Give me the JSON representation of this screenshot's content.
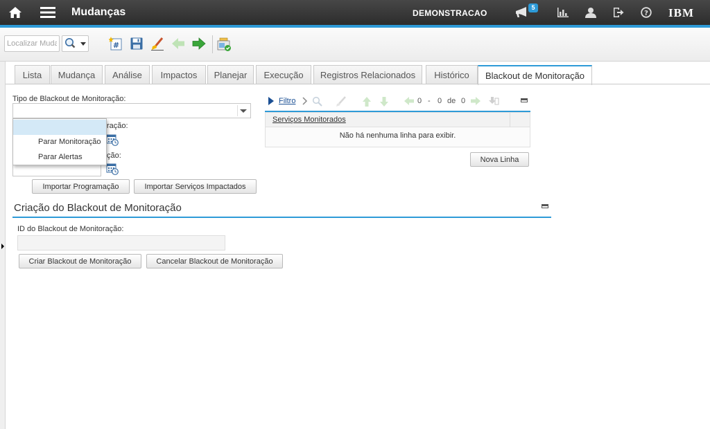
{
  "header": {
    "app_title": "Mudanças",
    "user": "DEMONSTRACAO",
    "notification_count": "5",
    "brand": "IBM",
    "accent_color": "#2d9ad7"
  },
  "toolbar": {
    "search_placeholder": "Localizar Mudança",
    "icons": [
      "new-record-icon",
      "save-icon",
      "clear-changes-icon",
      "previous-record-icon",
      "next-record-icon",
      "workflow-icon"
    ]
  },
  "tabs": [
    {
      "label": "Lista"
    },
    {
      "label": "Mudança"
    },
    {
      "label": "Análise"
    },
    {
      "label": "Impactos"
    },
    {
      "label": "Planejar"
    },
    {
      "label": "Execução"
    },
    {
      "label": "Registros Relacionados"
    },
    {
      "label": "Histórico"
    },
    {
      "label": "Blackout de Monitoração",
      "active": true
    }
  ],
  "form": {
    "type_label": "Tipo de Blackout de Monitoração:",
    "type_value": "",
    "start_label_fragment": "ração:",
    "end_label_fragment": "ção:",
    "dropdown_options": [
      "",
      "Parar Monitoração",
      "Parar Alertas"
    ],
    "import_schedule_button": "Importar Programação",
    "import_services_button": "Importar Serviços Impactados"
  },
  "table": {
    "filter_label": "Filtro",
    "pager_from": "0",
    "pager_dash": "-",
    "pager_to": "0",
    "pager_of": "de",
    "pager_total": "0",
    "column_header": "Serviços Monitorados",
    "empty_message": "Não há nenhuma linha para exibir.",
    "new_row_button": "Nova Linha"
  },
  "section": {
    "title": "Criação do Blackout de Monitoração",
    "id_label": "ID do Blackout de Monitoração:",
    "id_value": "",
    "create_button": "Criar Blackout de Monitoração",
    "cancel_button": "Cancelar Blackout de Monitoração"
  }
}
